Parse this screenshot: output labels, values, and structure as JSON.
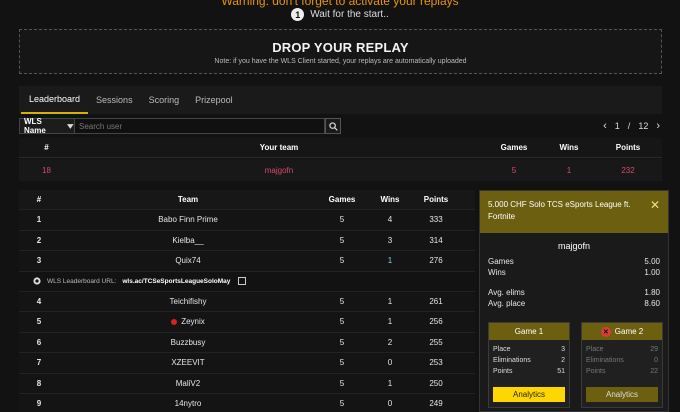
{
  "banner": {
    "warning": "Warning: don't forget to activate your replays",
    "step_number": "1",
    "step_text": "Wait for the start.."
  },
  "drop": {
    "title": "DROP YOUR REPLAY",
    "note": "Note: if you have the WLS Client started, your replays are automatically uploaded"
  },
  "tabs": [
    "Leaderboard",
    "Sessions",
    "Scoring",
    "Prizepool"
  ],
  "filter": {
    "select_value": "WLS Name",
    "search_placeholder": "Search user",
    "page_current": "1",
    "page_sep": "/",
    "page_total": "12"
  },
  "my_team": {
    "headers": [
      "#",
      "Your team",
      "Games",
      "Wins",
      "Points"
    ],
    "row": {
      "rank": "18",
      "team": "majgofn",
      "games": "5",
      "wins": "1",
      "points": "232"
    }
  },
  "leaderboard": {
    "headers": [
      "#",
      "Team",
      "Games",
      "Wins",
      "Points"
    ],
    "rows": [
      {
        "rank": "1",
        "team": "Babo Finn Prime",
        "games": "5",
        "wins": "4",
        "points": "333"
      },
      {
        "rank": "2",
        "team": "Kielba__",
        "games": "5",
        "wins": "3",
        "points": "314"
      },
      {
        "rank": "3",
        "team": "Quix74",
        "games": "5",
        "wins": "1",
        "points": "276"
      },
      {
        "rank": "4",
        "team": "Teichifishy",
        "games": "5",
        "wins": "1",
        "points": "261"
      },
      {
        "rank": "5",
        "team": "Zeynix",
        "games": "5",
        "wins": "1",
        "points": "256"
      },
      {
        "rank": "6",
        "team": "Buzzbusy",
        "games": "5",
        "wins": "2",
        "points": "255"
      },
      {
        "rank": "7",
        "team": "XZEEVIT",
        "games": "5",
        "wins": "0",
        "points": "253"
      },
      {
        "rank": "8",
        "team": "MaliV2",
        "games": "5",
        "wins": "1",
        "points": "250"
      },
      {
        "rank": "9",
        "team": "14nytro",
        "games": "5",
        "wins": "0",
        "points": "249"
      }
    ],
    "url_label": "WLS Leaderboard URL:",
    "url": "wls.ac/TCSeSportsLeagueSoloMay"
  },
  "panel": {
    "title": "5.000 CHF Solo TCS eSports League ft. Fortnite",
    "player": "majgofn",
    "stats": [
      {
        "label": "Games",
        "value": "5.00"
      },
      {
        "label": "Wins",
        "value": "1.00"
      },
      {
        "label": "Avg. elims",
        "value": "1.80"
      },
      {
        "label": "Avg. place",
        "value": "8.60"
      }
    ],
    "games": [
      {
        "title": "Game 1",
        "place_label": "Place",
        "place": "3",
        "elims_label": "Eliminations",
        "elims": "2",
        "points_label": "Points",
        "points": "51",
        "button": "Analytics"
      },
      {
        "title": "Game 2",
        "place_label": "Place",
        "place": "29",
        "elims_label": "Eliminations",
        "elims": "0",
        "points_label": "Points",
        "points": "22",
        "button": "Analytics"
      }
    ]
  },
  "colors": {
    "accent": "#ffd600",
    "warning": "#e8930c",
    "highlight_row": "#d94a6c",
    "panel_head": "#6c5f10"
  }
}
